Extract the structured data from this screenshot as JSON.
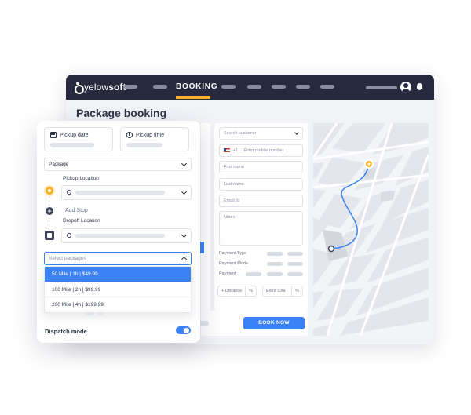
{
  "brand": {
    "logo_prefix": "yelow",
    "logo_suffix": "soft"
  },
  "nav": {
    "active_label": "BOOKING"
  },
  "page": {
    "title": "Package booking"
  },
  "customer_form": {
    "search_placeholder": "Search customer",
    "phone_code": "+1",
    "phone_placeholder": "Enter mobile number",
    "first_name_placeholder": "First name",
    "last_name_placeholder": "Last name",
    "email_placeholder": "Email Id",
    "notes_placeholder": "Notes",
    "payment_type_label": "Payment Type",
    "payment_mode_label": "Payment Mode",
    "payment_label": "Payment",
    "distance_label": "+ Distance",
    "distance_unit": "%",
    "extra_charge_label": "Extra Cha",
    "extra_charge_unit": "%",
    "book_now_label": "BOOK NOW"
  },
  "booking_card": {
    "pickup_date_label": "Pickup date",
    "pickup_time_label": "Pickup time",
    "service_type": "Package",
    "pickup_location_label": "Pickup Location",
    "add_stop_label": "Add Stop",
    "dropoff_location_label": "Dropoff Location",
    "packages_placeholder": "Select packages",
    "package_options": [
      {
        "label": "50 Mile | 1h | $49.99",
        "selected": true
      },
      {
        "label": "100 Mile | 2h | $99.99",
        "selected": false
      },
      {
        "label": "200 Mile | 4h | $199.99",
        "selected": false
      }
    ],
    "dispatch_mode_label": "Dispatch mode",
    "dispatch_mode_on": true
  },
  "colors": {
    "topbar": "#272a3e",
    "accent_blue": "#3b82f6",
    "accent_yellow": "#f4b32b"
  },
  "icons": [
    "calendar-icon",
    "clock-icon",
    "map-pin-icon",
    "chevron-down-icon",
    "chevron-up-icon",
    "user-avatar-icon",
    "bell-icon",
    "plus-icon",
    "flag-icon"
  ]
}
